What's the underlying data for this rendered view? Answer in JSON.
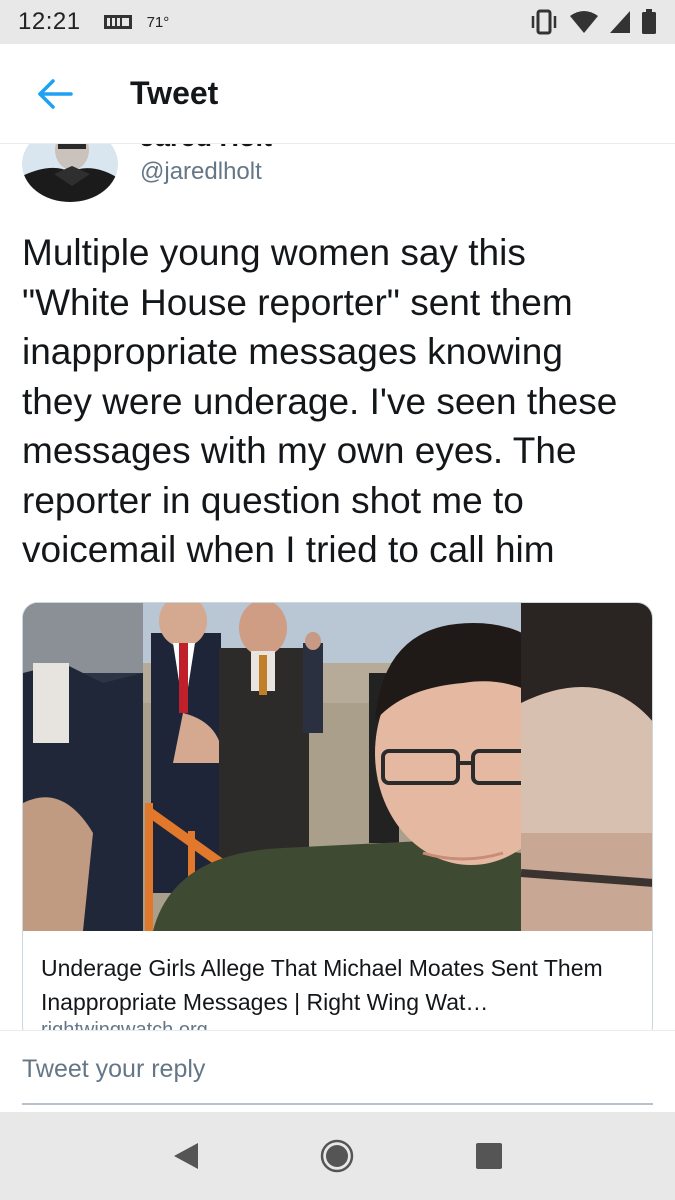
{
  "status_bar": {
    "time": "12:21",
    "temperature": "71°",
    "icons": [
      "news-icon",
      "vibrate-icon",
      "wifi-icon",
      "signal-icon",
      "battery-icon"
    ]
  },
  "app_bar": {
    "title": "Tweet",
    "back_icon": "arrow-left-icon",
    "accent_color": "#1da1f2"
  },
  "tweet": {
    "author_name": "Jared Holt",
    "handle": "@jaredlholt",
    "text": "Multiple young women say this\n\"White House reporter\" sent them\ninappropriate messages knowing\nthey were underage. I've seen these\nmessages with my own eyes. The\nreporter in question shot me to\nvoicemail when I tried to call him",
    "card": {
      "title": "Underage Girls Allege That Michael Moates Sent Them Inappropriate Messages | Right Wing Wat…",
      "domain": "rightwingwatch.org"
    }
  },
  "reply": {
    "placeholder": "Tweet your reply"
  },
  "nav_bar": {
    "buttons": [
      "back-triangle-icon",
      "home-circle-icon",
      "recents-square-icon"
    ]
  }
}
